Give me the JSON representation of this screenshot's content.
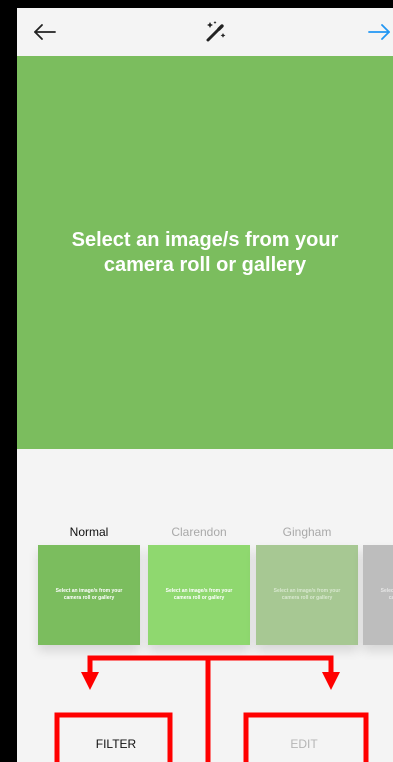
{
  "colors": {
    "accent": "#2196f3",
    "preview_bg": "#7bbd5e",
    "annotation": "#ff0000"
  },
  "topbar": {
    "back_icon": "arrow-left-icon",
    "magic_icon": "magic-wand-icon",
    "next_icon": "arrow-right-icon"
  },
  "preview": {
    "message": "Select an image/s from your camera roll or gallery"
  },
  "filters": [
    {
      "label": "Normal",
      "thumb_text": "Select an image/s from your camera roll or gallery",
      "color": "#7bbd5e",
      "selected": true
    },
    {
      "label": "Clarendon",
      "thumb_text": "Select an image/s from your camera roll or gallery",
      "color": "#8fd86f",
      "selected": false
    },
    {
      "label": "Gingham",
      "thumb_text": "Select an image/s from your camera roll or gallery",
      "color": "#a7c893",
      "selected": false
    },
    {
      "label": "",
      "thumb_text": "Select an image/s from your camera roll or gallery",
      "color": "#bdbdbd",
      "selected": false
    }
  ],
  "tabs": {
    "filter": "FILTER",
    "edit": "EDIT"
  }
}
